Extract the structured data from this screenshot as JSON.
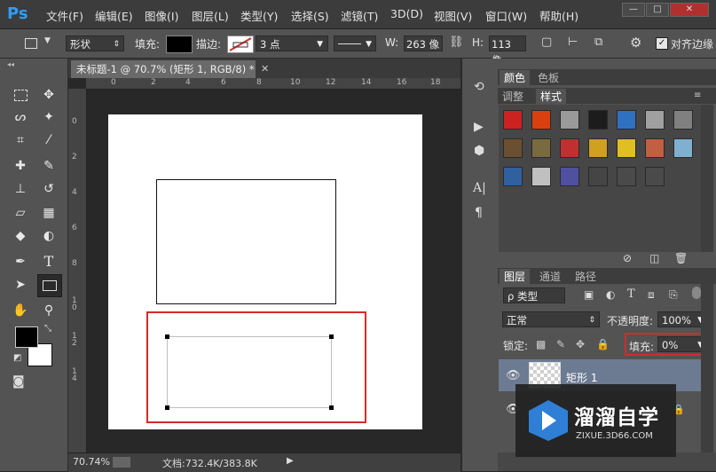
{
  "app": {
    "logo": "Ps"
  },
  "menu": [
    "文件(F)",
    "编辑(E)",
    "图像(I)",
    "图层(L)",
    "类型(Y)",
    "选择(S)",
    "滤镜(T)",
    "3D(D)",
    "视图(V)",
    "窗口(W)",
    "帮助(H)"
  ],
  "window_buttons": {
    "minimize": "—",
    "restore": "□",
    "close": "✕"
  },
  "options": {
    "mode": "形状",
    "fill_label": "填充:",
    "stroke_label": "描边:",
    "stroke_width": "3 点",
    "w_label": "W:",
    "w_value": "263 像",
    "h_label": "H:",
    "h_value": "113 像",
    "align_edges": "对齐边缘"
  },
  "document": {
    "tab_title": "未标题-1 @ 70.7% (矩形 1, RGB/8) *",
    "zoom": "70.74%",
    "doc_info": "文档:732.4K/383.8K"
  },
  "rulers": {
    "top": [
      "0",
      "2",
      "4",
      "6",
      "8",
      "10",
      "12",
      "14",
      "16",
      "18"
    ],
    "left": [
      "0",
      "2",
      "4",
      "6",
      "8",
      "1 0",
      "1 2",
      "1 4"
    ]
  },
  "panels": {
    "color_tabs": [
      "颜色",
      "色板"
    ],
    "style_tabs": [
      "调整",
      "样式"
    ],
    "layer_tabs": [
      "图层",
      "通道",
      "路径"
    ],
    "filter_kind": "ρ 类型",
    "blend_mode": "正常",
    "opacity_label": "不透明度:",
    "opacity_value": "100%",
    "lock_label": "锁定:",
    "fill_label": "填充:",
    "fill_value": "0%",
    "layer1_name": "矩形 1"
  },
  "style_swatches": [
    "#cc2222",
    "#d84010",
    "#9a9a9a",
    "#1c1c1c",
    "#3070c0",
    "#a0a0a0",
    "#808080",
    "#6a5030",
    "#7a6a40",
    "#c03030",
    "#d0a020",
    "#e0c020",
    "#c06040",
    "#80b0d0",
    "#3060a0",
    "#c0c0c0",
    "#5050a0",
    "#454545",
    "#4a4a4a",
    "#4a4a4a"
  ],
  "watermark": {
    "brand": "溜溜自学",
    "site": "ZIXUE.3D66.COM"
  },
  "colors": {
    "highlight": "#d32b2b",
    "brand_blue": "#2f9cf5"
  }
}
